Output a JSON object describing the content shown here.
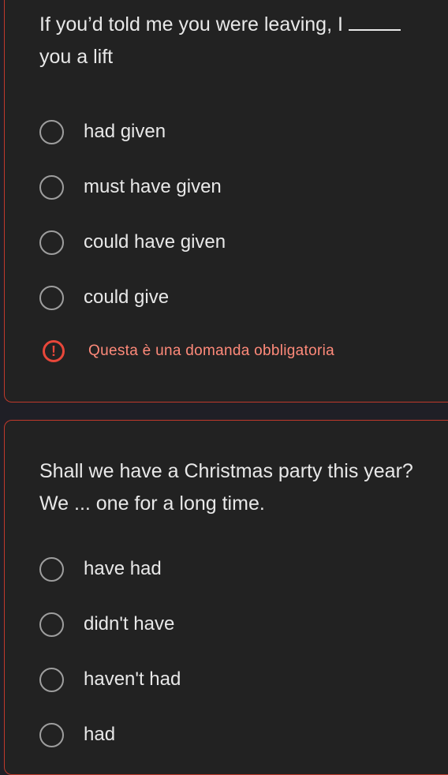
{
  "questions": [
    {
      "line1_before_blank": "If you’d told me you were leaving, I ",
      "line2": "you a lift",
      "options": [
        "had given",
        "must have given",
        "could have given",
        "could give"
      ],
      "required_message": "Questa è una domanda obbligatoria"
    },
    {
      "line1": "Shall we have a Christmas party this year?",
      "line2": "We ... one for a long time.",
      "options": [
        "have had",
        "didn't have",
        "haven't had",
        "had"
      ]
    }
  ],
  "icons": {
    "radio": "radio-unchecked-icon",
    "warning": "exclamation-circle-icon"
  },
  "colors": {
    "background": "#1f1f26",
    "card": "#222222",
    "card_border": "#c0392b",
    "error": "#e8473a",
    "error_text": "#ff8a7a",
    "text": "#e8e8e8"
  }
}
